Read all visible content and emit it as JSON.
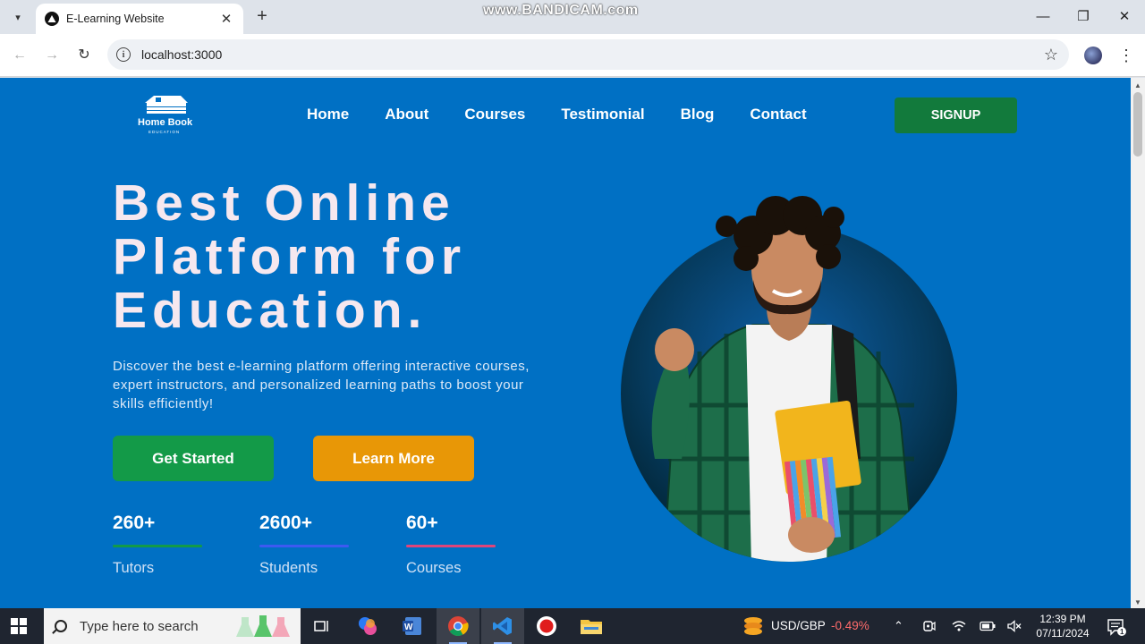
{
  "browser": {
    "tab_title": "E-Learning Website",
    "url": "localhost:3000",
    "watermark": "www.BANDICAM.com",
    "tab_close": "✕",
    "new_tab": "+",
    "window_controls": {
      "minimize": "—",
      "restore": "❐",
      "close": "✕"
    },
    "icons": {
      "back": "←",
      "forward": "→",
      "reload": "↻",
      "star": "☆",
      "menu": "⋮",
      "tab_list": "▾"
    }
  },
  "site": {
    "logo_text": "Home Book",
    "logo_subtext": "EDUCATION",
    "nav": [
      "Home",
      "About",
      "Courses",
      "Testimonial",
      "Blog",
      "Contact"
    ],
    "signup_label": "SIGNUP",
    "hero": {
      "title_lines": [
        "Best Online",
        "Platform for",
        "Education."
      ],
      "description": "Discover the best e-learning platform offering interactive courses, expert instructors, and personalized learning paths to boost your skills efficiently!",
      "primary_cta": "Get Started",
      "secondary_cta": "Learn More"
    },
    "stats": [
      {
        "value": "260+",
        "label": "Tutors",
        "bar_color": "#139a48"
      },
      {
        "value": "2600+",
        "label": "Students",
        "bar_color": "#3d5af1"
      },
      {
        "value": "60+",
        "label": "Courses",
        "bar_color": "#e0457b"
      }
    ],
    "colors": {
      "background": "#0070c4",
      "primary_green": "#139a48",
      "signup_green": "#127a3c",
      "amber": "#e89706"
    }
  },
  "taskbar": {
    "search_placeholder": "Type here to search",
    "currency_pair": "USD/GBP",
    "currency_change": "-0.49%",
    "time": "12:39 PM",
    "date": "07/11/2024",
    "notification_count": "1"
  }
}
